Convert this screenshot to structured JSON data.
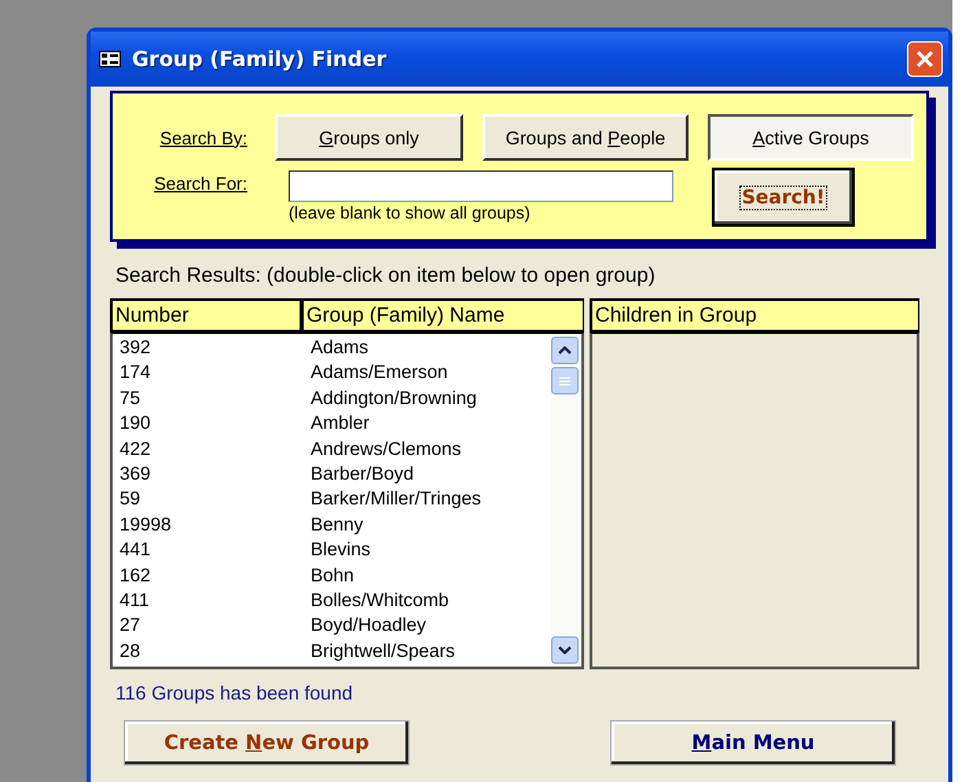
{
  "window": {
    "title": "Group (Family) Finder"
  },
  "search_by": {
    "label": "Search By:",
    "options": [
      {
        "key": "G",
        "after": "roups only",
        "selected": false
      },
      {
        "before": "Groups and ",
        "key": "P",
        "after": "eople",
        "selected": false
      },
      {
        "key": "A",
        "after": "ctive Groups",
        "selected": true
      }
    ]
  },
  "search_for": {
    "label": "Search For:",
    "hint": "(leave blank to show all groups)"
  },
  "search_button": {
    "label": "Search!",
    "focused": true
  },
  "results_caption": "Search Results: (double-click on item below to open group)",
  "columns": [
    "Number",
    "Group (Family) Name",
    "Children in Group"
  ],
  "rows": [
    {
      "number": "392",
      "name": "Adams"
    },
    {
      "number": "174",
      "name": "Adams/Emerson"
    },
    {
      "number": "75",
      "name": "Addington/Browning"
    },
    {
      "number": "190",
      "name": "Ambler"
    },
    {
      "number": "422",
      "name": "Andrews/Clemons"
    },
    {
      "number": "369",
      "name": "Barber/Boyd"
    },
    {
      "number": "59",
      "name": "Barker/Miller/Tringes"
    },
    {
      "number": "19998",
      "name": "Benny"
    },
    {
      "number": "441",
      "name": "Blevins"
    },
    {
      "number": "162",
      "name": "Bohn"
    },
    {
      "number": "411",
      "name": "Bolles/Whitcomb"
    },
    {
      "number": "27",
      "name": "Boyd/Hoadley"
    },
    {
      "number": "28",
      "name": "Brightwell/Spears"
    }
  ],
  "status": "116  Groups has been found",
  "buttons": [
    {
      "kind": "create",
      "before": "Create ",
      "key": "N",
      "after": "ew Group"
    },
    {
      "kind": "menu",
      "key": "M",
      "after": "ain Menu"
    }
  ]
}
